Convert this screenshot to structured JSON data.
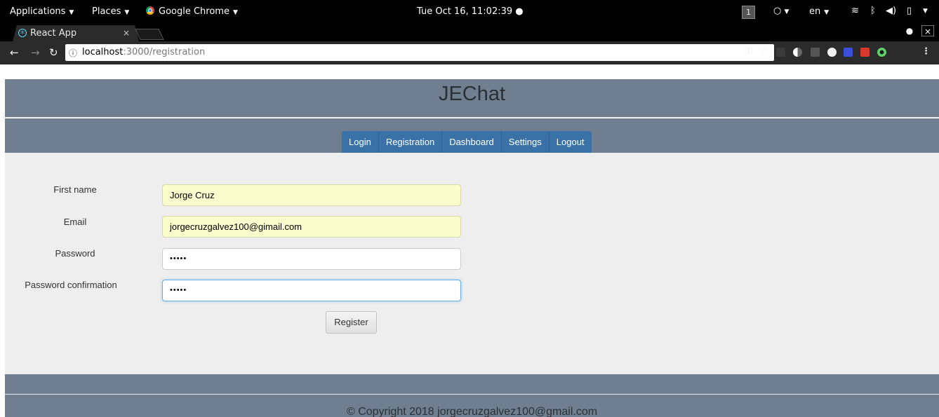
{
  "system_bar": {
    "applications": "Applications",
    "places": "Places",
    "active_app": "Google Chrome",
    "clock": "Tue Oct 16, 11:02:39 ●",
    "workspace": "1",
    "language": "en"
  },
  "browser": {
    "tab_title": "React App",
    "url_host": "localhost",
    "url_path": ":3000/registration"
  },
  "site": {
    "title": "JEChat",
    "nav": [
      "Login",
      "Registration",
      "Dashboard",
      "Settings",
      "Logout"
    ],
    "nav_color": "#3a72a8",
    "header_color": "#6f7f8f"
  },
  "form": {
    "first_name_label": "First name",
    "first_name_value": "Jorge Cruz",
    "email_label": "Email",
    "email_value": "jorgecruzgalvez100@gimail.com",
    "password_label": "Password",
    "password_value": "•••••",
    "password_confirmation_label": "Password confirmation",
    "password_confirmation_value": "•••••",
    "register_label": "Register"
  },
  "footer": {
    "copyright": "© Copyright 2018 jorgecruzgalvez100@gmail.com"
  }
}
